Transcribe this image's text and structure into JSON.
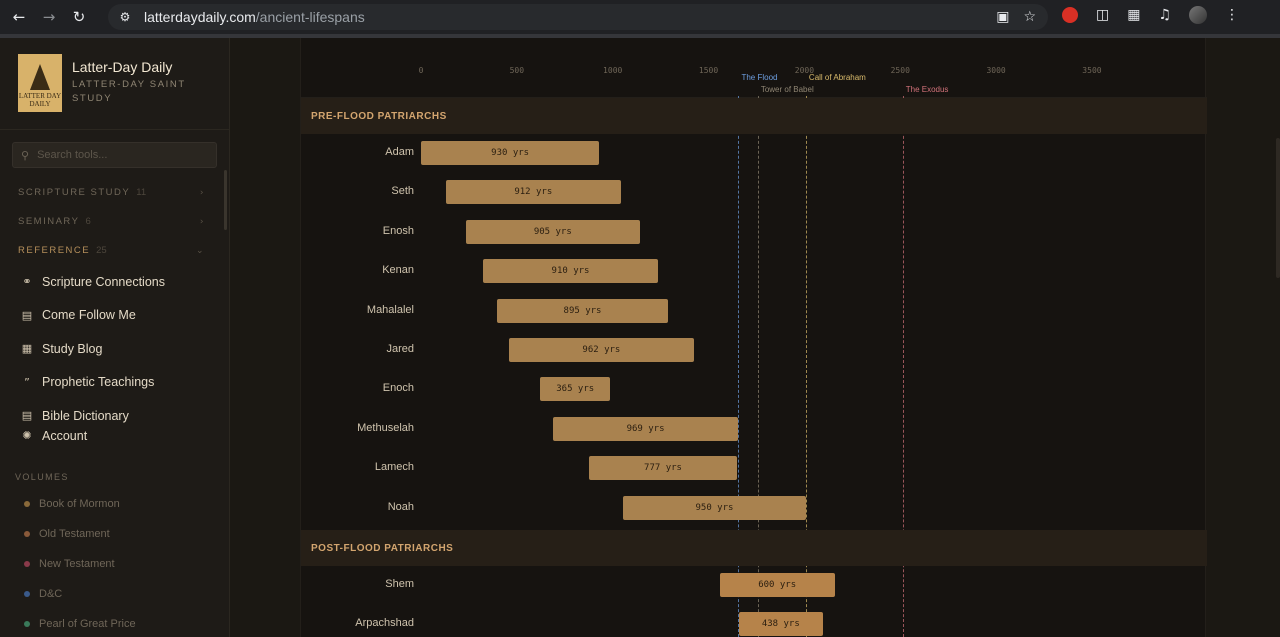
{
  "browser": {
    "domain": "latterdaydaily.com",
    "path": "/ancient-lifespans"
  },
  "brand": {
    "title": "Latter-Day Daily",
    "subtitle": "Latter-Day Saint Study",
    "logo_text": "LATTER DAY DAILY"
  },
  "search": {
    "placeholder": "Search tools..."
  },
  "sections": [
    {
      "label": "Scripture Study",
      "count": "11"
    },
    {
      "label": "Seminary",
      "count": "6"
    },
    {
      "label": "Reference",
      "count": "25"
    }
  ],
  "reference_items": [
    {
      "label": "Scripture Connections",
      "icon": "link-icon"
    },
    {
      "label": "Come Follow Me",
      "icon": "calendar-icon"
    },
    {
      "label": "Study Blog",
      "icon": "newspaper-icon"
    },
    {
      "label": "Prophetic Teachings",
      "icon": "quote-icon"
    },
    {
      "label": "Bible Dictionary",
      "icon": "book-icon"
    }
  ],
  "account": {
    "label": "Account",
    "icon": "gear-icon"
  },
  "volumes": {
    "heading": "Volumes",
    "items": [
      {
        "label": "Book of Mormon",
        "color": "#8a6a3a"
      },
      {
        "label": "Old Testament",
        "color": "#8a5a3a"
      },
      {
        "label": "New Testament",
        "color": "#8a3a4a"
      },
      {
        "label": "D&C",
        "color": "#3a5a8a"
      },
      {
        "label": "Pearl of Great Price",
        "color": "#3a7a5a"
      }
    ]
  },
  "chart_data": {
    "type": "bar",
    "orientation": "horizontal-range",
    "x_ticks": [
      "0",
      "500",
      "1000",
      "1500",
      "2000",
      "2500",
      "3000",
      "3500"
    ],
    "xlim": [
      0,
      3500
    ],
    "events": [
      {
        "name": "The Flood",
        "year": 1656,
        "color": "#6d9ee0",
        "row": 1
      },
      {
        "name": "Tower of Babel",
        "year": 1757,
        "color": "#8f8573",
        "row": 2
      },
      {
        "name": "Call of Abraham",
        "year": 2008,
        "color": "#d9bb6c",
        "row": 1
      },
      {
        "name": "The Exodus",
        "year": 2513,
        "color": "#d2727a",
        "row": 2
      }
    ],
    "groups": [
      {
        "title": "PRE-FLOOD PATRIARCHS",
        "rows": [
          {
            "name": "Adam",
            "start": 0,
            "end": 930,
            "label": "930 yrs"
          },
          {
            "name": "Seth",
            "start": 130,
            "end": 1042,
            "label": "912 yrs"
          },
          {
            "name": "Enosh",
            "start": 235,
            "end": 1140,
            "label": "905 yrs"
          },
          {
            "name": "Kenan",
            "start": 325,
            "end": 1235,
            "label": "910 yrs"
          },
          {
            "name": "Mahalalel",
            "start": 395,
            "end": 1290,
            "label": "895 yrs"
          },
          {
            "name": "Jared",
            "start": 460,
            "end": 1422,
            "label": "962 yrs"
          },
          {
            "name": "Enoch",
            "start": 622,
            "end": 987,
            "label": "365 yrs"
          },
          {
            "name": "Methuselah",
            "start": 687,
            "end": 1656,
            "label": "969 yrs"
          },
          {
            "name": "Lamech",
            "start": 874,
            "end": 1651,
            "label": "777 yrs"
          },
          {
            "name": "Noah",
            "start": 1056,
            "end": 2006,
            "label": "950 yrs"
          }
        ]
      },
      {
        "title": "POST-FLOOD PATRIARCHS",
        "rows": [
          {
            "name": "Shem",
            "start": 1558,
            "end": 2158,
            "label": "600 yrs"
          },
          {
            "name": "Arpachshad",
            "start": 1658,
            "end": 2096,
            "label": "438 yrs"
          }
        ]
      }
    ]
  }
}
